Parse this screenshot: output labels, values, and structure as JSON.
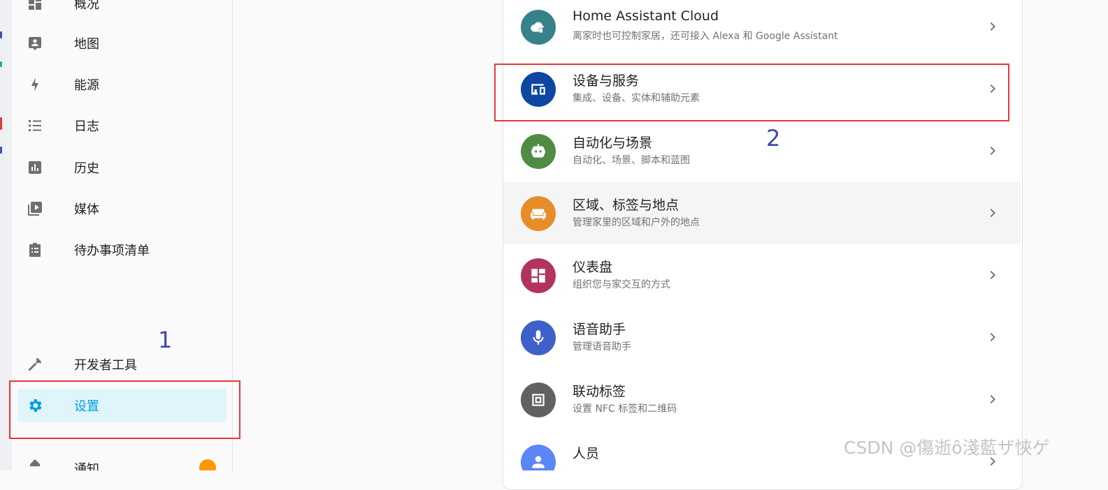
{
  "colors": {
    "sidebar_bg": "#fafafa",
    "active_bg": "#e0f4fc",
    "active_color": "#039be5",
    "annotation_red": "#e53935",
    "annotation_blue": "#3949ab",
    "badge": "#ff9800"
  },
  "sidebar": {
    "items": [
      {
        "label": "概况",
        "icon": "dashboard-grid-icon"
      },
      {
        "label": "地图",
        "icon": "account-box-icon"
      },
      {
        "label": "能源",
        "icon": "lightning-bolt-icon"
      },
      {
        "label": "日志",
        "icon": "format-list-icon"
      },
      {
        "label": "历史",
        "icon": "chart-box-icon"
      },
      {
        "label": "媒体",
        "icon": "play-box-multiple-icon"
      },
      {
        "label": "待办事项清单",
        "icon": "clipboard-list-icon"
      }
    ],
    "bottom": [
      {
        "label": "开发者工具",
        "icon": "hammer-icon"
      },
      {
        "label": "设置",
        "icon": "gear-icon",
        "active": true
      },
      {
        "label": "通知",
        "icon": "bell-icon"
      }
    ]
  },
  "annotations": {
    "label_1": "1",
    "label_2": "2"
  },
  "settings": {
    "rows": [
      {
        "title": "Home Assistant Cloud",
        "desc": "离家时也可控制家居，还可接入 Alexa 和 Google Assistant",
        "icon": "cloud-lock-icon",
        "color": "#37818a"
      },
      {
        "title": "设备与服务",
        "desc": "集成、设备、实体和辅助元素",
        "icon": "devices-icon",
        "color": "#0d47a1"
      },
      {
        "title": "自动化与场景",
        "desc": "自动化、场景、脚本和蓝图",
        "icon": "robot-icon",
        "color": "#518c43"
      },
      {
        "title": "区域、标签与地点",
        "desc": "管理家里的区域和户外的地点",
        "icon": "sofa-icon",
        "color": "#e68d2a"
      },
      {
        "title": "仪表盘",
        "desc": "组织您与家交互的方式",
        "icon": "dashboard-icon",
        "color": "#b1345c"
      },
      {
        "title": "语音助手",
        "desc": "管理语音助手",
        "icon": "microphone-icon",
        "color": "#3e60c9"
      },
      {
        "title": "联动标签",
        "desc": "设置 NFC 标签和二维码",
        "icon": "nfc-tag-icon",
        "color": "#616161"
      },
      {
        "title": "人员",
        "desc": "",
        "icon": "person-icon",
        "color": "#5c85f5"
      }
    ]
  },
  "watermark": "CSDN @傷逝ô淺藍ザ悏ゲ"
}
